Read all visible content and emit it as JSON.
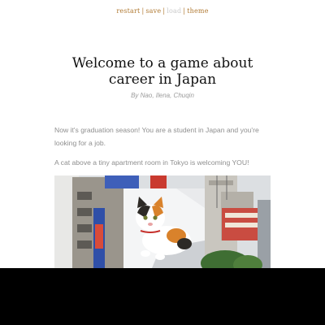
{
  "menu": {
    "restart": "restart",
    "save": "save",
    "load": "load",
    "theme": "theme",
    "separator": "|"
  },
  "story": {
    "title": "Welcome to a game about career in Japan",
    "byline": "By Nao, Ilena, Chuqin",
    "paragraphs": [
      "Now it's graduation season! You are a student in Japan and you're looking for a job.",
      "A cat above a tiny apartment room in Tokyo is welcoming YOU!"
    ]
  }
}
